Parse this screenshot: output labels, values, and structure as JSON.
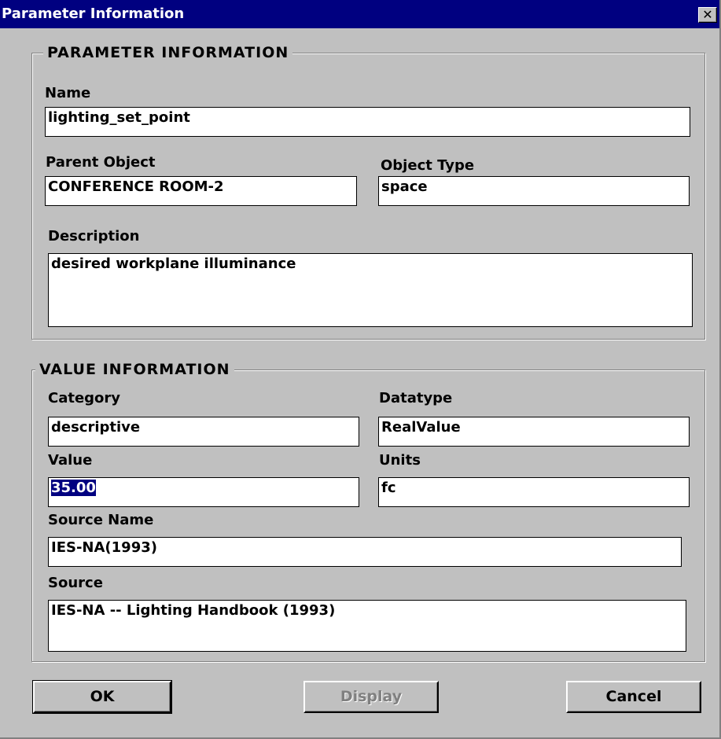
{
  "window": {
    "title": "Parameter Information",
    "close_glyph": "✕"
  },
  "parameter_info": {
    "legend": "PARAMETER INFORMATION",
    "name_label": "Name",
    "name_value": "lighting_set_point",
    "parent_label": "Parent Object",
    "parent_value": "CONFERENCE ROOM-2",
    "type_label": "Object Type",
    "type_value": "space",
    "description_label": "Description",
    "description_value": "desired workplane illuminance"
  },
  "value_info": {
    "legend": "VALUE INFORMATION",
    "category_label": "Category",
    "category_value": "descriptive",
    "datatype_label": "Datatype",
    "datatype_value": "RealValue",
    "value_label": "Value",
    "value_value": "35.00",
    "units_label": "Units",
    "units_value": "fc",
    "source_name_label": "Source Name",
    "source_name_value": "IES-NA(1993)",
    "source_label": "Source",
    "source_value": "IES-NA  -- Lighting Handbook (1993)"
  },
  "buttons": {
    "ok": "OK",
    "display": "Display",
    "cancel": "Cancel"
  }
}
